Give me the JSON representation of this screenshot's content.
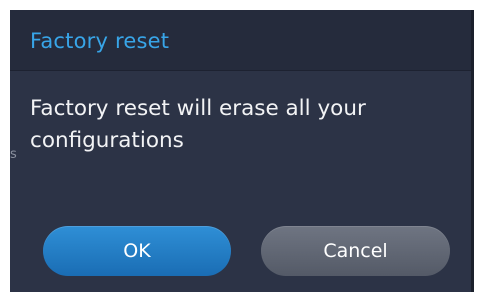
{
  "dialog": {
    "title": "Factory reset",
    "message": "Factory reset will erase all your configurations",
    "edge_fragment": "s",
    "buttons": {
      "ok_label": "OK",
      "cancel_label": "Cancel"
    }
  },
  "colors": {
    "title_text": "#38a5e8",
    "dialog_background": "#2c3346",
    "header_background": "#252b3c",
    "ok_button": "#1f7ac4",
    "cancel_button": "#5f6572",
    "message_text": "#f2f3f5"
  }
}
